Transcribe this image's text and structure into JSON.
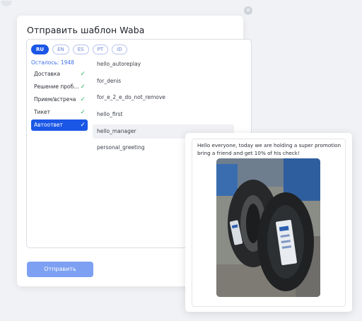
{
  "modal": {
    "title": "Отправить шаблон Waba",
    "close_icon": "close-icon",
    "languages": [
      {
        "code": "RU",
        "active": true
      },
      {
        "code": "EN",
        "active": false
      },
      {
        "code": "ES",
        "active": false
      },
      {
        "code": "PT",
        "active": false
      },
      {
        "code": "ID",
        "active": false
      }
    ],
    "remaining": "Осталось: 1948",
    "categories": [
      {
        "label": "Доставка",
        "checked": true,
        "active": false
      },
      {
        "label": "Решение проб...",
        "checked": true,
        "active": false
      },
      {
        "label": "Прием/встреча",
        "checked": true,
        "active": false
      },
      {
        "label": "Тикет",
        "checked": true,
        "active": false
      },
      {
        "label": "Автоответ",
        "checked": true,
        "active": true
      }
    ],
    "templates": [
      {
        "name": "hello_autoreplay",
        "hover": false
      },
      {
        "name": "for_denis",
        "hover": false
      },
      {
        "name": "for_e_2_e_do_not_remove",
        "hover": false
      },
      {
        "name": "hello_first",
        "hover": false
      },
      {
        "name": "hello_manager",
        "hover": true
      },
      {
        "name": "personal_greeting",
        "hover": false
      }
    ],
    "send_label": "Отправить"
  },
  "preview": {
    "message": "Hello everyone, today we are holding a super promotion bring a friend and get 10% of his check!",
    "image_icon": "tires-photo"
  },
  "colors": {
    "accent": "#1b57e6",
    "send_button": "#7da0f2",
    "check": "#2fb86a",
    "remaining_text": "#3d6ee8"
  }
}
